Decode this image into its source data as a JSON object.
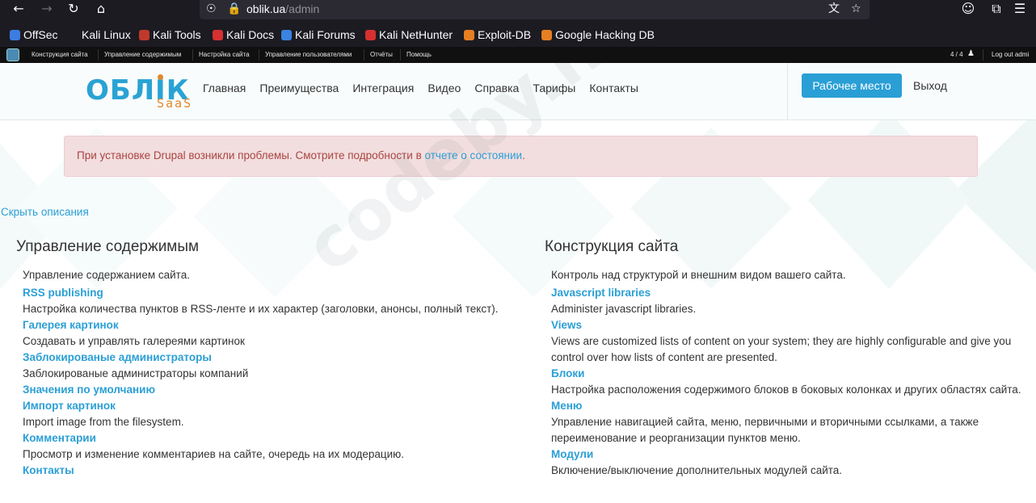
{
  "browser": {
    "url_host": "oblik.ua",
    "url_path": "/admin",
    "bookmarks": [
      {
        "label": "OffSec",
        "color": "#3b7de1"
      },
      {
        "label": "Kali Linux",
        "color": "#1c1b22"
      },
      {
        "label": "Kali Tools",
        "color": "#c0392b"
      },
      {
        "label": "Kali Docs",
        "color": "#d63031"
      },
      {
        "label": "Kali Forums",
        "color": "#3c82e0"
      },
      {
        "label": "Kali NetHunter",
        "color": "#d63031"
      },
      {
        "label": "Exploit-DB",
        "color": "#e67e22"
      },
      {
        "label": "Google Hacking DB",
        "color": "#e67e22"
      }
    ]
  },
  "admin_menu": {
    "items": [
      "Конструкция сайта",
      "Управление содержимым",
      "Настройка сайта",
      "Управление пользователями",
      "Отчёты",
      "Помощь"
    ],
    "counter": "4 / 4",
    "logout": "Log out admi"
  },
  "header": {
    "logo_main": "ОБЛІК",
    "logo_sub": "SaaS",
    "nav": [
      "Главная",
      "Преимущества",
      "Интеграция",
      "Видео",
      "Справка",
      "Тарифы",
      "Контакты"
    ],
    "workspace_button": "Рабочее место",
    "logout": "Выход"
  },
  "message": {
    "text": "При установке Drupal возникли проблемы. Смотрите подробности в ",
    "link": "отчете о состоянии",
    "end": "."
  },
  "hide_descriptions": "Скрыть описания",
  "watermark": "codeby.net",
  "left_column": {
    "title": "Управление содержимым",
    "description": "Управление содержанием сайта.",
    "items": [
      {
        "title": "RSS publishing",
        "desc": "Настройка количества пунктов в RSS-ленте и их характер (заголовки, анонсы, полный текст)."
      },
      {
        "title": "Галерея картинок",
        "desc": "Создавать и управлять галереями картинок"
      },
      {
        "title": "Заблокированые администраторы",
        "desc": "Заблокированые администраторы компаний"
      },
      {
        "title": "Значения по умолчанию",
        "desc": ""
      },
      {
        "title": "Импорт картинок",
        "desc": "Import image from the filesystem."
      },
      {
        "title": "Комментарии",
        "desc": "Просмотр и изменение комментариев на сайте, очередь на их модерацию."
      },
      {
        "title": "Контакты",
        "desc": ""
      }
    ]
  },
  "right_column": {
    "title": "Конструкция сайта",
    "description": "Контроль над структурой и внешним видом вашего сайта.",
    "items": [
      {
        "title": "Javascript libraries",
        "desc": "Administer javascript libraries."
      },
      {
        "title": "Views",
        "desc": "Views are customized lists of content on your system; they are highly configurable and give you control over how lists of content are presented."
      },
      {
        "title": "Блоки",
        "desc": "Настройка расположения содержимого блоков в боковых колонках и других областях сайта."
      },
      {
        "title": "Меню",
        "desc": "Управление навигацией сайта, меню, первичными и вторичными ссылками, а также переименование и реорганизации пунктов меню."
      },
      {
        "title": "Модули",
        "desc": "Включение/выключение дополнительных модулей сайта."
      }
    ]
  }
}
